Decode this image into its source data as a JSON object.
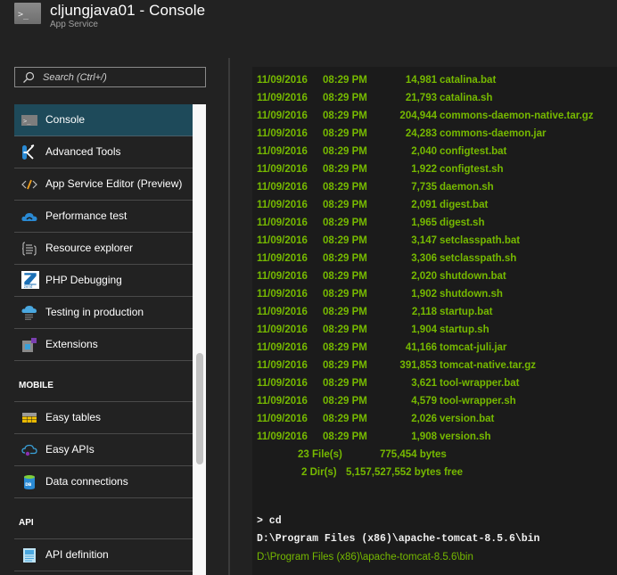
{
  "header": {
    "title": "cljungjava01 - Console",
    "subtitle": "App Service",
    "icon": "console-icon"
  },
  "search": {
    "placeholder": "Search (Ctrl+/)",
    "value": ""
  },
  "sidebar": {
    "items": [
      {
        "label": "Console",
        "icon": "console-icon",
        "active": true
      },
      {
        "label": "Advanced Tools",
        "icon": "kudu-icon"
      },
      {
        "label": "App Service Editor (Preview)",
        "icon": "code-editor-icon"
      },
      {
        "label": "Performance test",
        "icon": "cloud-gauge-icon"
      },
      {
        "label": "Resource explorer",
        "icon": "resource-explorer-icon"
      },
      {
        "label": "PHP Debugging",
        "icon": "zend-icon"
      },
      {
        "label": "Testing in production",
        "icon": "cloud-testing-icon"
      },
      {
        "label": "Extensions",
        "icon": "extensions-icon"
      }
    ],
    "sections": [
      {
        "title": "MOBILE",
        "items": [
          {
            "label": "Easy tables",
            "icon": "table-icon"
          },
          {
            "label": "Easy APIs",
            "icon": "cloud-api-icon"
          },
          {
            "label": "Data connections",
            "icon": "database-icon"
          }
        ]
      },
      {
        "title": "API",
        "items": [
          {
            "label": "API definition",
            "icon": "api-document-icon"
          }
        ]
      }
    ]
  },
  "console": {
    "listing": [
      {
        "date": "11/09/2016",
        "time": "08:29 PM",
        "size": "14,981",
        "name": "catalina.bat"
      },
      {
        "date": "11/09/2016",
        "time": "08:29 PM",
        "size": "21,793",
        "name": "catalina.sh"
      },
      {
        "date": "11/09/2016",
        "time": "08:29 PM",
        "size": "204,944",
        "name": "commons-daemon-native.tar.gz"
      },
      {
        "date": "11/09/2016",
        "time": "08:29 PM",
        "size": "24,283",
        "name": "commons-daemon.jar"
      },
      {
        "date": "11/09/2016",
        "time": "08:29 PM",
        "size": "2,040",
        "name": "configtest.bat"
      },
      {
        "date": "11/09/2016",
        "time": "08:29 PM",
        "size": "1,922",
        "name": "configtest.sh"
      },
      {
        "date": "11/09/2016",
        "time": "08:29 PM",
        "size": "7,735",
        "name": "daemon.sh"
      },
      {
        "date": "11/09/2016",
        "time": "08:29 PM",
        "size": "2,091",
        "name": "digest.bat"
      },
      {
        "date": "11/09/2016",
        "time": "08:29 PM",
        "size": "1,965",
        "name": "digest.sh"
      },
      {
        "date": "11/09/2016",
        "time": "08:29 PM",
        "size": "3,147",
        "name": "setclasspath.bat"
      },
      {
        "date": "11/09/2016",
        "time": "08:29 PM",
        "size": "3,306",
        "name": "setclasspath.sh"
      },
      {
        "date": "11/09/2016",
        "time": "08:29 PM",
        "size": "2,020",
        "name": "shutdown.bat"
      },
      {
        "date": "11/09/2016",
        "time": "08:29 PM",
        "size": "1,902",
        "name": "shutdown.sh"
      },
      {
        "date": "11/09/2016",
        "time": "08:29 PM",
        "size": "2,118",
        "name": "startup.bat"
      },
      {
        "date": "11/09/2016",
        "time": "08:29 PM",
        "size": "1,904",
        "name": "startup.sh"
      },
      {
        "date": "11/09/2016",
        "time": "08:29 PM",
        "size": "41,166",
        "name": "tomcat-juli.jar"
      },
      {
        "date": "11/09/2016",
        "time": "08:29 PM",
        "size": "391,853",
        "name": "tomcat-native.tar.gz"
      },
      {
        "date": "11/09/2016",
        "time": "08:29 PM",
        "size": "3,621",
        "name": "tool-wrapper.bat"
      },
      {
        "date": "11/09/2016",
        "time": "08:29 PM",
        "size": "4,579",
        "name": "tool-wrapper.sh"
      },
      {
        "date": "11/09/2016",
        "time": "08:29 PM",
        "size": "2,026",
        "name": "version.bat"
      },
      {
        "date": "11/09/2016",
        "time": "08:29 PM",
        "size": "1,908",
        "name": "version.sh"
      }
    ],
    "summary": {
      "files_count": "23 File(s)",
      "files_bytes": "775,454 bytes",
      "dirs_count": "2 Dir(s)",
      "dirs_free": "5,157,527,552 bytes free"
    },
    "command": "> cd",
    "command_output": "D:\\Program Files (x86)\\apache-tomcat-8.5.6\\bin",
    "prompt_path": "D:\\Program Files (x86)\\apache-tomcat-8.5.6\\bin"
  },
  "colors": {
    "background": "#222222",
    "console_background": "#1b1b1b",
    "console_green": "#76b900",
    "active_item": "#1e4a5a",
    "divider": "#4a4a4a"
  }
}
